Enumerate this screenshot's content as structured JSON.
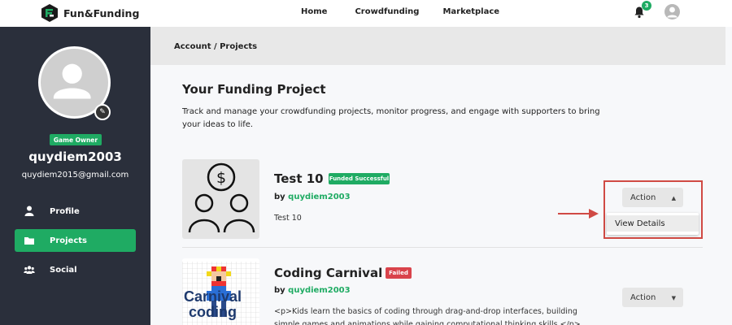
{
  "app": {
    "name": "Fun&Funding"
  },
  "nav": {
    "home": "Home",
    "crowdfunding": "Crowdfunding",
    "marketplace": "Marketplace"
  },
  "notifications": {
    "count": "3"
  },
  "profile": {
    "role": "Game Owner",
    "username": "quydiem2003",
    "email": "quydiem2015@gmail.com"
  },
  "sidebar": {
    "items": [
      {
        "label": "Profile",
        "icon": "person-icon"
      },
      {
        "label": "Projects",
        "icon": "folder-icon",
        "active": true
      },
      {
        "label": "Social",
        "icon": "group-icon"
      }
    ]
  },
  "breadcrumb": "Account / Projects",
  "page": {
    "title": "Your Funding Project",
    "description": "Track and manage your crowdfunding projects, monitor progress, and engage with supporters to bring your ideas to life."
  },
  "projects": [
    {
      "title": "Test 10",
      "status": "Funded Successful",
      "by_prefix": "by ",
      "owner": "quydiem2003",
      "description": "Test 10",
      "action": "Action",
      "dropdown": [
        "View Details"
      ]
    },
    {
      "title": "Coding Carnival",
      "status": "Failed",
      "by_prefix": "by ",
      "owner": "quydiem2003",
      "description": "<p>Kids learn the basics of coding through drag-and-drop interfaces, building simple games and animations while gaining computational thinking skills.</p>",
      "thumb_text_1": "Carnival",
      "thumb_text_2": "coding",
      "action": "Action"
    }
  ],
  "colors": {
    "accent": "#1fab63",
    "sidebar": "#2a2f3b",
    "danger": "#d9434b",
    "annotation": "#d04a44"
  }
}
